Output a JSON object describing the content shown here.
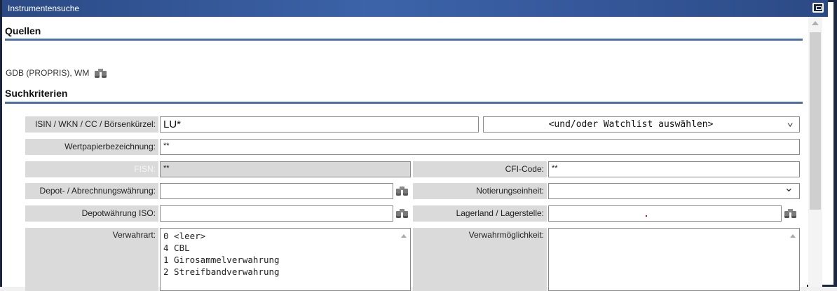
{
  "window": {
    "title": "Instrumentensuche"
  },
  "sections": {
    "sources_title": "Quellen",
    "criteria_title": "Suchkriterien"
  },
  "sources": {
    "text": "GDB (PROPRIS), WM",
    "icon": "binoculars-icon"
  },
  "fields": {
    "isin": {
      "label": "ISIN / WKN / CC / Börsenkürzel:",
      "value": "LU*"
    },
    "watchlist": {
      "value": "<und/oder Watchlist auswählen>"
    },
    "wertpapier": {
      "label": "Wertpapierbezeichnung:",
      "value": "**"
    },
    "fisn": {
      "label": "FISN:",
      "value": "**"
    },
    "cfi": {
      "label": "CFI-Code:",
      "value": "**"
    },
    "depot_waehrung": {
      "label": "Depot- / Abrechnungswährung:",
      "value": ""
    },
    "notierung": {
      "label": "Notierungseinheit:",
      "value": ""
    },
    "depot_iso": {
      "label": "Depotwährung ISO:",
      "value": ""
    },
    "lagerland": {
      "label": "Lagerland / Lagerstelle:",
      "value": ""
    },
    "verwahrart": {
      "label": "Verwahrart:",
      "options": [
        "0 <leer>",
        "4 CBL",
        "1 Girosammelverwahrung",
        "2 Streifbandverwahrung"
      ]
    },
    "verwahrmoeglichkeit": {
      "label": "Verwahrmöglichkeit:",
      "options": []
    }
  },
  "colors": {
    "titlebar": "#3c63a8",
    "accent_rule": "#4a6fa8",
    "label_bg": "#dadada"
  }
}
